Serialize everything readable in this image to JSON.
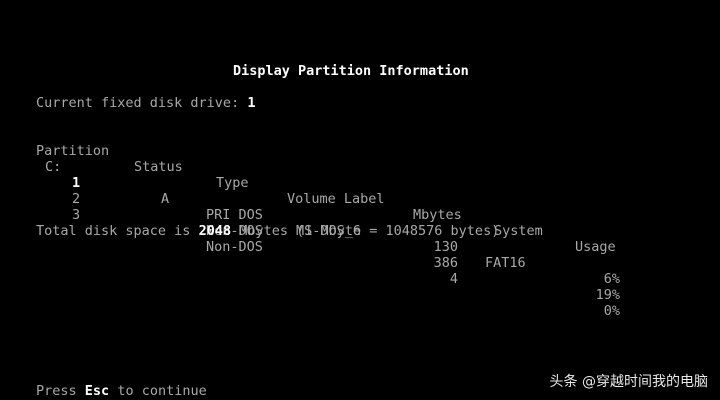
{
  "screen": {
    "title": "Display Partition Information",
    "current_drive_label": "Current fixed disk drive:",
    "current_drive_value": "1"
  },
  "table": {
    "headers": {
      "partition": "Partition",
      "status": "Status",
      "type": "Type",
      "volume_label": "Volume Label",
      "mbytes": "Mbytes",
      "system": "System",
      "usage": "Usage"
    },
    "rows": [
      {
        "drive": "C:",
        "partition": "1",
        "status": "A",
        "type": "PRI DOS",
        "volume_label": "MS-DOS_6",
        "mbytes": "130",
        "system": "FAT16",
        "usage": "6%"
      },
      {
        "drive": "",
        "partition": "2",
        "status": "",
        "type": "Non-DOS",
        "volume_label": "",
        "mbytes": "386",
        "system": "",
        "usage": "19%"
      },
      {
        "drive": "",
        "partition": "3",
        "status": "",
        "type": "Non-DOS",
        "volume_label": "",
        "mbytes": "4",
        "system": "",
        "usage": "0%"
      }
    ]
  },
  "total": {
    "prefix": "Total disk space is",
    "value": "2048",
    "suffix": "Mbytes (1 Mbyte = 1048576 bytes)"
  },
  "footer": {
    "press": "Press",
    "key": "Esc",
    "continue": "to continue"
  },
  "watermark": "头条 @穿越时间我的电脑",
  "colors": {
    "background": "#000000",
    "text": "#a8a8a8",
    "highlight": "#ffffff"
  }
}
